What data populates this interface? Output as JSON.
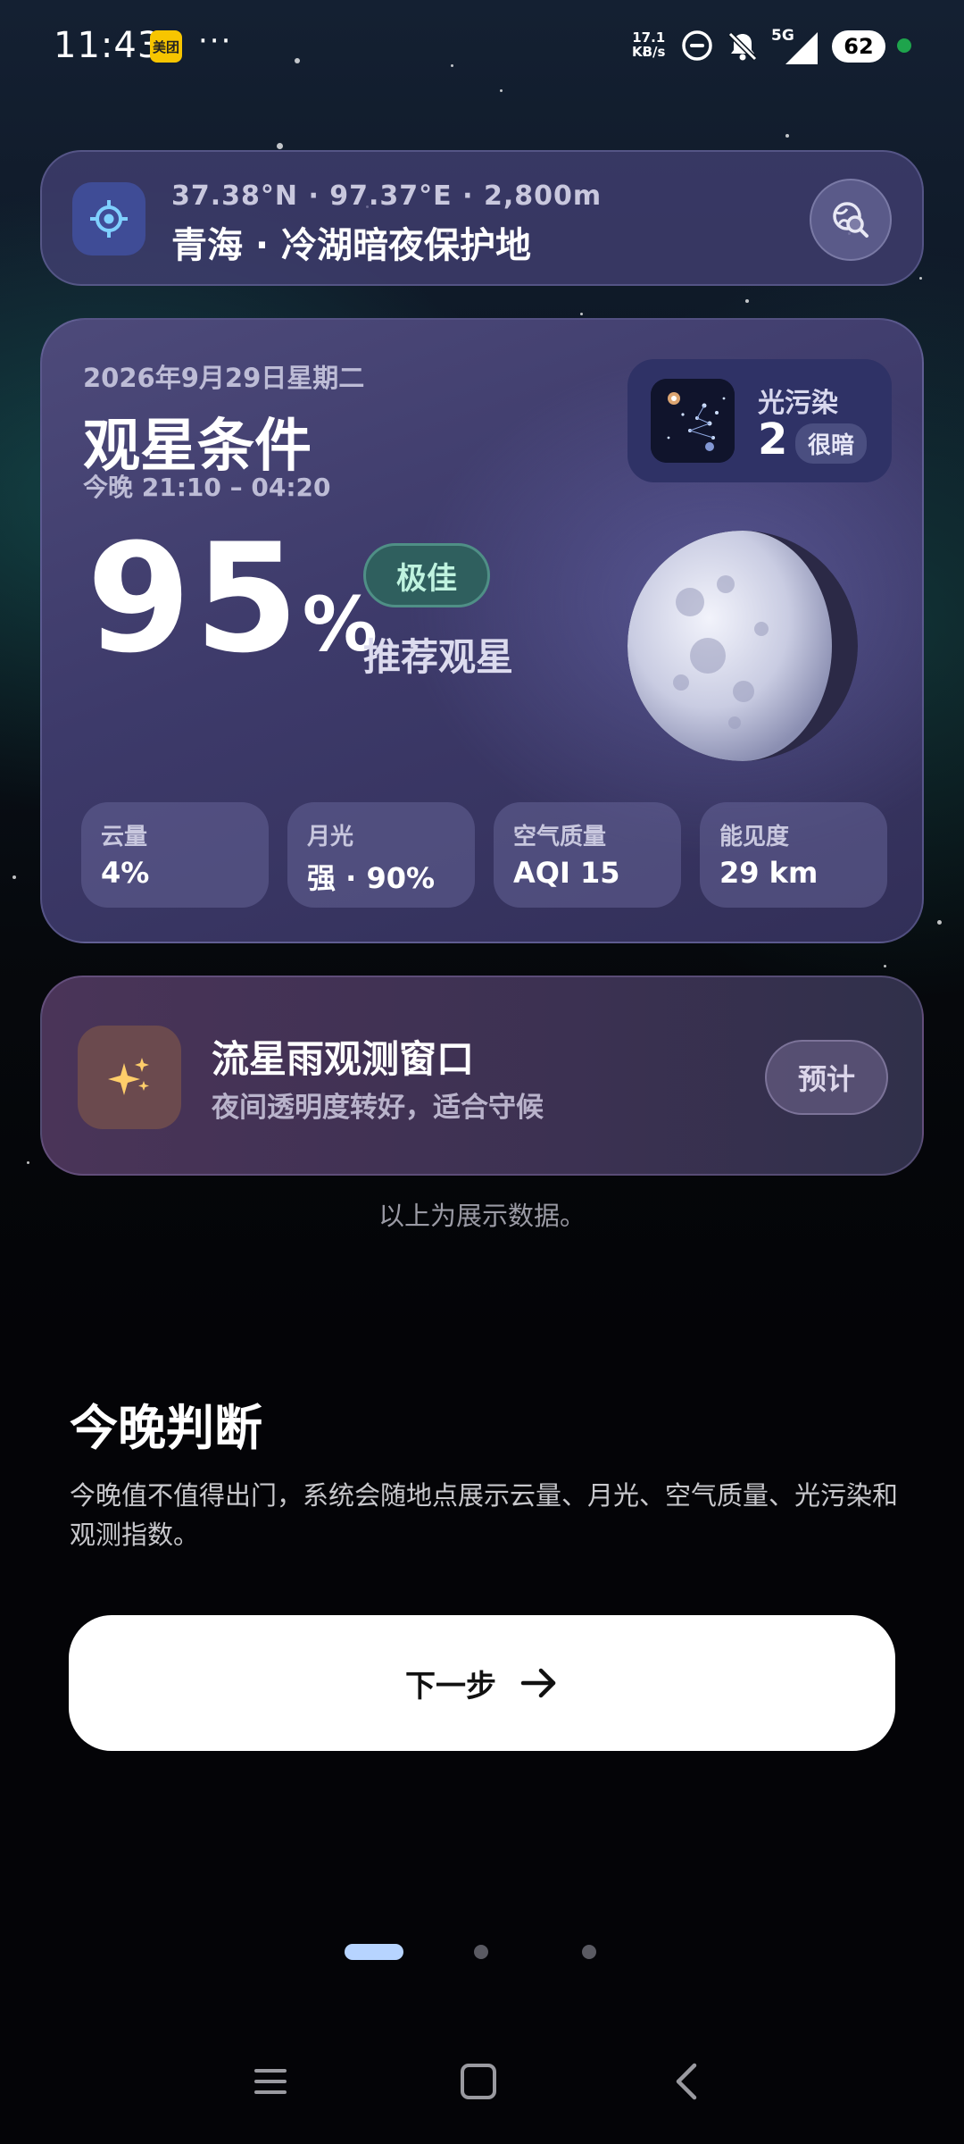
{
  "status_bar": {
    "time": "11:43",
    "app_badge": "美团",
    "more": "···",
    "net_speed_value": "17.1",
    "net_speed_unit": "KB/s",
    "signal_label": "5G",
    "battery": "62"
  },
  "location": {
    "coords": "37.38°N · 97.37°E · 2,800m",
    "name": "青海 · 冷湖暗夜保护地"
  },
  "conditions": {
    "date": "2026年9月29日星期二",
    "title": "观星条件",
    "time_range": "今晚 21:10 – 04:20",
    "score": "95",
    "score_unit": "%",
    "rating": "极佳",
    "recommendation": "推荐观星",
    "light_pollution": {
      "label": "光污染",
      "value": "2",
      "tag": "很暗"
    },
    "metrics": [
      {
        "label": "云量",
        "value": "4%"
      },
      {
        "label": "月光",
        "value": "强 · 90%"
      },
      {
        "label": "空气质量",
        "value": "AQI 15"
      },
      {
        "label": "能见度",
        "value": "29 km"
      }
    ]
  },
  "meteor": {
    "title": "流星雨观测窗口",
    "subtitle": "夜间透明度转好，适合守候",
    "button": "预计"
  },
  "demo_note": "以上为展示数据。",
  "intro": {
    "title": "今晚判断",
    "description": "今晚值不值得出门，系统会随地点展示云量、月光、空气质量、光污染和观测指数。"
  },
  "next_button": "下一步",
  "pager": {
    "total": 3,
    "active": 1
  },
  "colors": {
    "accent": "#b7d4ff",
    "rating_bg": "#2f5f5e",
    "rating_text": "#bff3df",
    "location_icon": "#7fd0ff",
    "meteor_icon": "#ffce6a"
  }
}
